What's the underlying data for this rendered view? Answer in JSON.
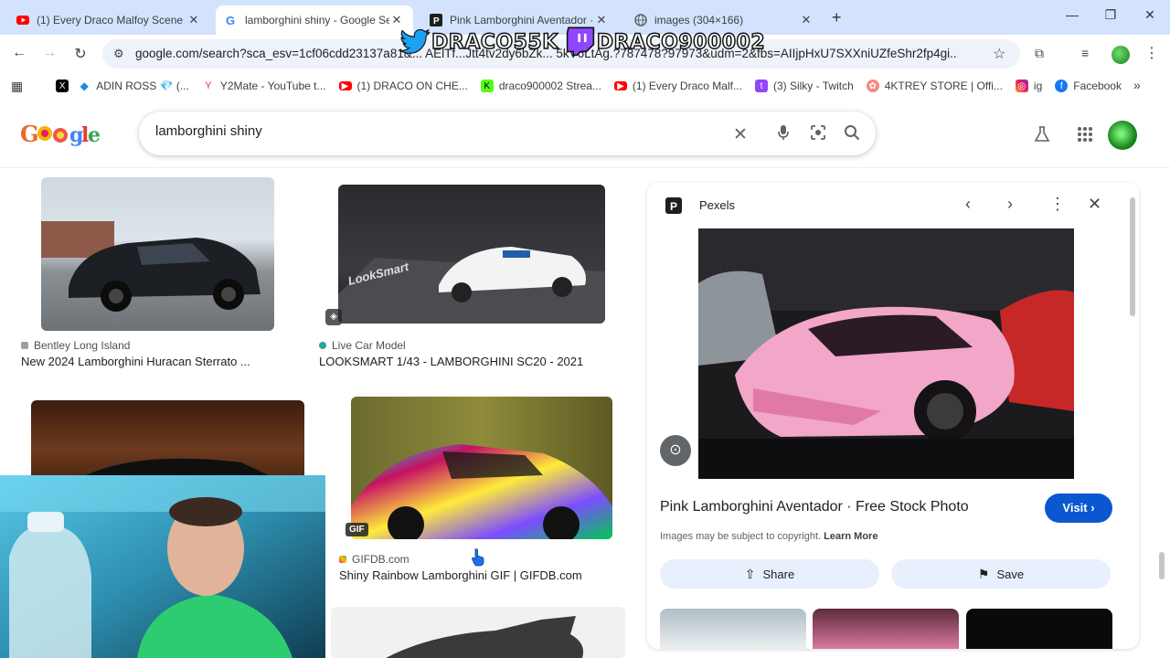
{
  "tabs": [
    {
      "title": "(1) Every Draco Malfoy Scene -",
      "icon": "youtube-icon",
      "active": false
    },
    {
      "title": "lamborghini shiny - Google Sea",
      "icon": "google-icon",
      "active": true
    },
    {
      "title": "Pink Lamborghini Aventador · F",
      "icon": "pexels-icon",
      "active": false
    },
    {
      "title": "images (304×166)",
      "icon": "globe-icon",
      "active": false
    }
  ],
  "address_bar": {
    "url": "google.com/search?sca_esv=1cf06cdd23137a81&... AElTf...Jtt4tv2dy6bZk... 5kV6LtAg.?787478?97973&udm=2&fbs=AIIjpHxU7SXXniUZfeShr2fp4gi..."
  },
  "bookmarks": [
    {
      "label": "",
      "icon": "x-icon"
    },
    {
      "label": "ADIN ROSS 💎 (...",
      "icon": "diamond-icon"
    },
    {
      "label": "Y2Mate - YouTube t...",
      "icon": "y2mate-icon"
    },
    {
      "label": "(1) DRACO ON CHE...",
      "icon": "youtube-icon"
    },
    {
      "label": "draco900002 Strea...",
      "icon": "kick-icon"
    },
    {
      "label": "(1) Every Draco Malf...",
      "icon": "youtube-icon"
    },
    {
      "label": "(3) Silky - Twitch",
      "icon": "twitch-icon"
    },
    {
      "label": "4KTREY STORE | Offi...",
      "icon": "store-icon"
    },
    {
      "label": "ig",
      "icon": "instagram-icon"
    },
    {
      "label": "Facebook",
      "icon": "facebook-icon"
    }
  ],
  "overlay": {
    "twitter_handle": "DRACO55K",
    "twitch_handle": "DRACO900002"
  },
  "search": {
    "query": "lamborghini shiny"
  },
  "results": [
    {
      "source": "Bentley Long Island",
      "caption": "New 2024 Lamborghini Huracan Sterrato ..."
    },
    {
      "source": "Live Car Model",
      "caption": "LOOKSMART 1/43 - LAMBORGHINI SC20 - 2021"
    },
    {
      "source": "GIFDB.com",
      "caption": "Shiny Rainbow Lamborghini GIF | GIFDB.com",
      "badge": "GIF"
    }
  ],
  "panel": {
    "site": "Pexels",
    "title": "Pink Lamborghini Aventador · Free Stock Photo",
    "visit_label": "Visit",
    "copyright_text": "Images may be subject to copyright.",
    "learn_more": "Learn More",
    "share_label": "Share",
    "save_label": "Save"
  },
  "thumb_texts": {
    "looksmart": "LookSmart"
  },
  "colors": {
    "tab_strip": "#d3e3fd",
    "visit_button": "#0b57d0",
    "pill_bg": "#e8f0fe"
  }
}
